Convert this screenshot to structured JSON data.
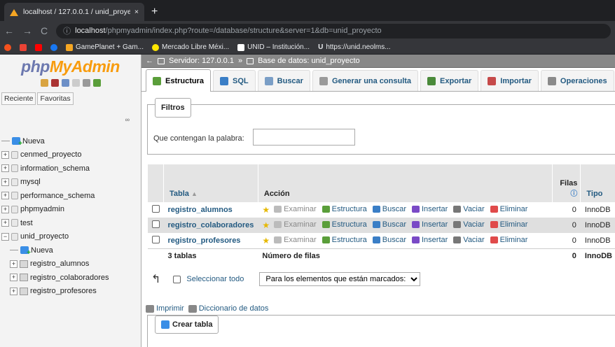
{
  "browser": {
    "tab_title": "localhost / 127.0.0.1 / unid_proye",
    "tab_close": "×",
    "new_tab": "+",
    "url_host": "localhost",
    "url_path": "/phpmyadmin/index.php?route=/database/structure&server=1&db=unid_proyecto",
    "bookmarks": [
      {
        "label": "GamePlanet + Gam...",
        "color": "#f5a623"
      },
      {
        "label": "Mercado Libre Méxi...",
        "color": "#ffe600"
      },
      {
        "label": "UNID – Institución...",
        "color": "#ffffff"
      },
      {
        "label": "https://unid.neolms...",
        "color": "#ffffff"
      }
    ]
  },
  "sidebar": {
    "logo_a": "php",
    "logo_b": "MyAdmin",
    "recent": "Reciente",
    "favorites": "Favoritas",
    "link_icon": "∞",
    "tree": [
      {
        "label": "Nueva",
        "kind": "new",
        "level": 0
      },
      {
        "label": "cenmed_proyecto",
        "kind": "db",
        "level": 0,
        "exp": "+"
      },
      {
        "label": "information_schema",
        "kind": "db",
        "level": 0,
        "exp": "+"
      },
      {
        "label": "mysql",
        "kind": "db",
        "level": 0,
        "exp": "+"
      },
      {
        "label": "performance_schema",
        "kind": "db",
        "level": 0,
        "exp": "+"
      },
      {
        "label": "phpmyadmin",
        "kind": "db",
        "level": 0,
        "exp": "+"
      },
      {
        "label": "test",
        "kind": "db",
        "level": 0,
        "exp": "+"
      },
      {
        "label": "unid_proyecto",
        "kind": "db",
        "level": 0,
        "exp": "−"
      },
      {
        "label": "Nueva",
        "kind": "new",
        "level": 1
      },
      {
        "label": "registro_alumnos",
        "kind": "table",
        "level": 1,
        "exp": "+"
      },
      {
        "label": "registro_colaboradores",
        "kind": "table",
        "level": 1,
        "exp": "+"
      },
      {
        "label": "registro_profesores",
        "kind": "table",
        "level": 1,
        "exp": "+"
      }
    ]
  },
  "breadcrumb": {
    "server": "Servidor: 127.0.0.1",
    "sep": "»",
    "db": "Base de datos: unid_proyecto"
  },
  "tabs": [
    {
      "label": "Estructura",
      "color": "#5a9e3a"
    },
    {
      "label": "SQL",
      "color": "#3a7ec6"
    },
    {
      "label": "Buscar",
      "color": "#7a9ec6"
    },
    {
      "label": "Generar una consulta",
      "color": "#9a9a9a"
    },
    {
      "label": "Exportar",
      "color": "#4a8a3a"
    },
    {
      "label": "Importar",
      "color": "#c64a4a"
    },
    {
      "label": "Operaciones",
      "color": "#8a8a8a"
    }
  ],
  "filters": {
    "legend": "Filtros",
    "label": "Que contengan la palabra:",
    "value": ""
  },
  "table": {
    "headers": {
      "name": "Tabla",
      "sort": "▲",
      "action": "Acción",
      "rows": "Filas",
      "type": "Tipo"
    },
    "actions": [
      "Examinar",
      "Estructura",
      "Buscar",
      "Insertar",
      "Vaciar",
      "Eliminar"
    ],
    "action_colors": [
      "#bbbbbb",
      "#5a9e3a",
      "#3a7ec6",
      "#7a4ac6",
      "#777777",
      "#e04a4a"
    ],
    "rows": [
      {
        "name": "registro_alumnos",
        "rows": "0",
        "type": "InnoDB"
      },
      {
        "name": "registro_colaboradores",
        "rows": "0",
        "type": "InnoDB"
      },
      {
        "name": "registro_profesores",
        "rows": "0",
        "type": "InnoDB"
      }
    ],
    "summary": {
      "count": "3 tablas",
      "label": "Número de filas",
      "rows": "0",
      "type": "InnoDB"
    }
  },
  "with_selected": {
    "select_all": "Seleccionar todo",
    "dropdown": "Para los elementos que están marcados:"
  },
  "footer_links": {
    "print": "Imprimir",
    "dictionary": "Diccionario de datos"
  },
  "create": {
    "legend": "Crear tabla"
  }
}
